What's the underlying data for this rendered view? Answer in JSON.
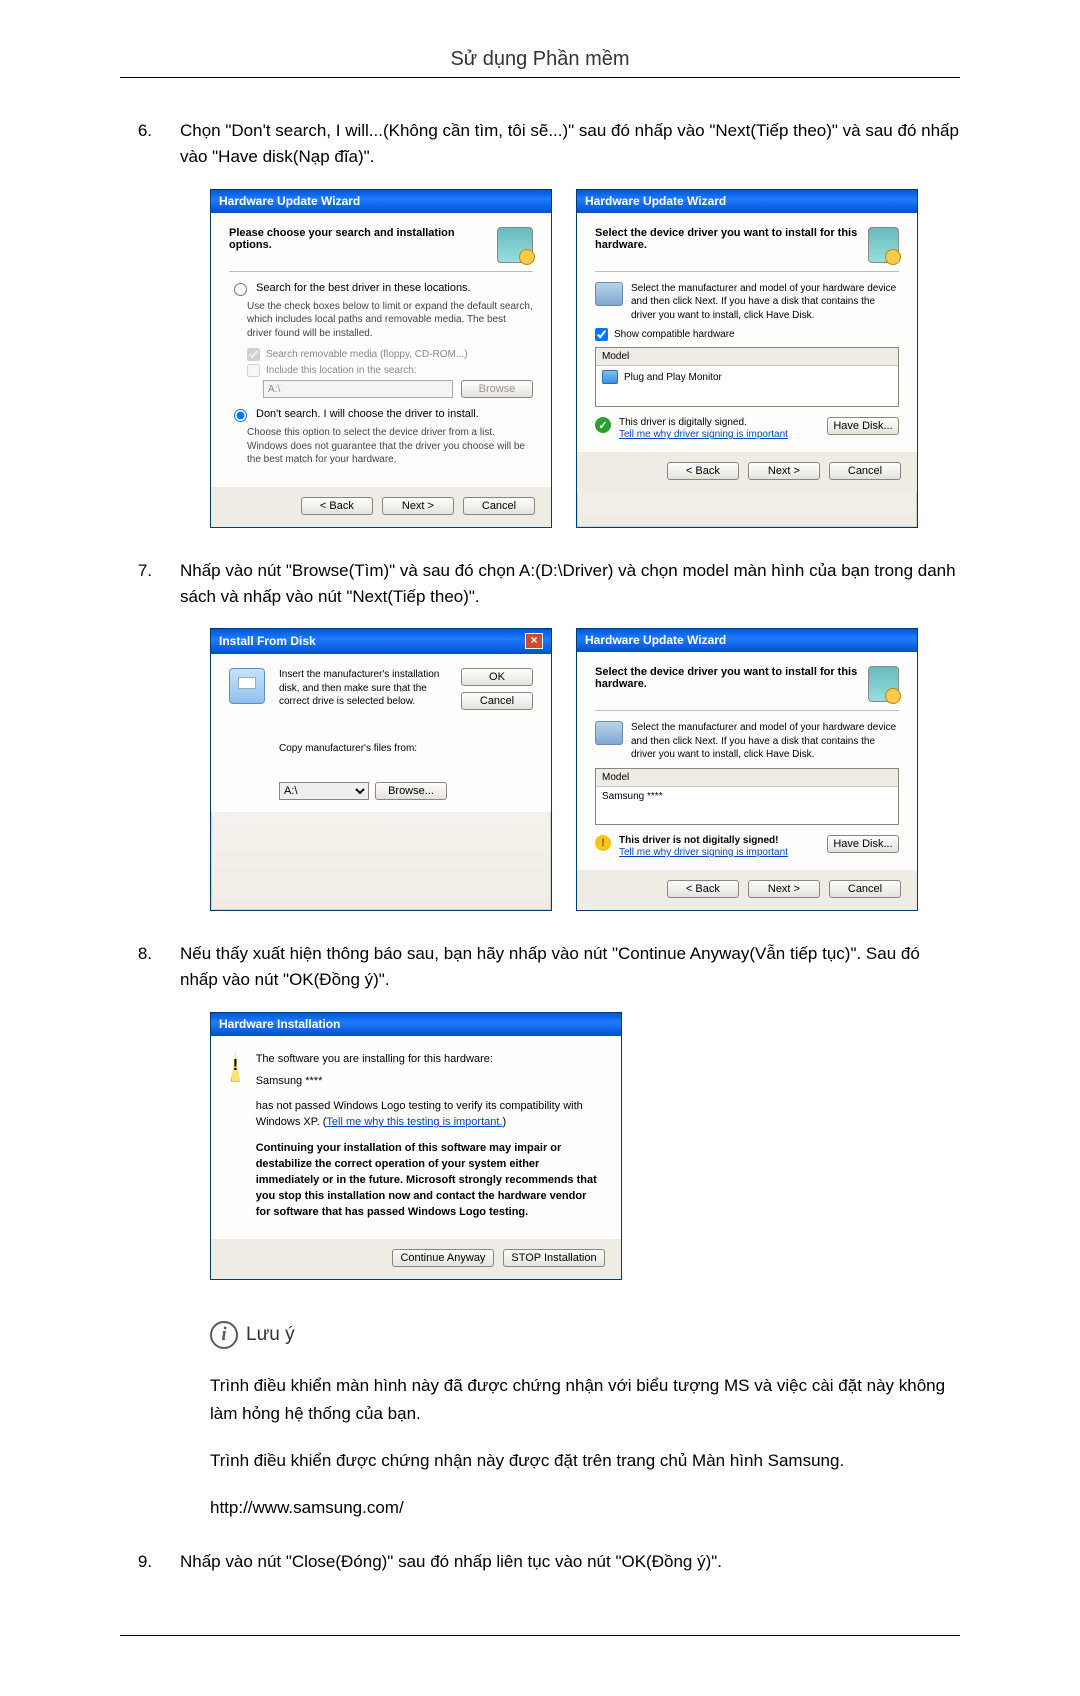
{
  "header": {
    "title": "Sử dụng Phần mềm"
  },
  "steps": {
    "s6": {
      "num": "6.",
      "text": "Chọn \"Don't search, I will...(Không cần tìm, tôi sẽ...)\" sau đó nhấp vào \"Next(Tiếp theo)\" và sau đó nhấp vào \"Have disk(Nạp đĩa)\"."
    },
    "s7": {
      "num": "7.",
      "text": "Nhấp vào nút \"Browse(Tìm)\" và sau đó chọn A:(D:\\Driver) và chọn model màn hình của bạn trong danh sách và nhấp vào nút \"Next(Tiếp theo)\"."
    },
    "s8": {
      "num": "8.",
      "text": "Nếu thấy xuất hiện thông báo sau, bạn hãy nhấp vào nút \"Continue Anyway(Vẫn tiếp tục)\". Sau đó nhấp vào nút \"OK(Đồng ý)\"."
    },
    "s9": {
      "num": "9.",
      "text": "Nhấp vào nút \"Close(Đóng)\" sau đó nhấp liên tục vào nút \"OK(Đồng ý)\"."
    }
  },
  "dlg1": {
    "title": "Hardware Update Wizard",
    "head": "Please choose your search and installation options.",
    "r1": "Search for the best driver in these locations.",
    "r1sub": "Use the check boxes below to limit or expand the default search, which includes local paths and removable media. The best driver found will be installed.",
    "c1": "Search removable media (floppy, CD-ROM...)",
    "c2": "Include this location in the search:",
    "path": "A:\\",
    "browse": "Browse",
    "r2": "Don't search. I will choose the driver to install.",
    "r2sub": "Choose this option to select the device driver from a list. Windows does not guarantee that the driver you choose will be the best match for your hardware.",
    "back": "< Back",
    "next": "Next >",
    "cancel": "Cancel"
  },
  "dlg2": {
    "title": "Hardware Update Wizard",
    "head": "Select the device driver you want to install for this hardware.",
    "info": "Select the manufacturer and model of your hardware device and then click Next. If you have a disk that contains the driver you want to install, click Have Disk.",
    "show": "Show compatible hardware",
    "model_head": "Model",
    "model_item": "Plug and Play Monitor",
    "signed": "This driver is digitally signed.",
    "tell": "Tell me why driver signing is important",
    "have": "Have Disk...",
    "back": "< Back",
    "next": "Next >",
    "cancel": "Cancel"
  },
  "ifd": {
    "title": "Install From Disk",
    "msg": "Insert the manufacturer's installation disk, and then make sure that the correct drive is selected below.",
    "ok": "OK",
    "cancel": "Cancel",
    "copy": "Copy manufacturer's files from:",
    "path": "A:\\",
    "browse": "Browse..."
  },
  "dlg3": {
    "title": "Hardware Update Wizard",
    "head": "Select the device driver you want to install for this hardware.",
    "info": "Select the manufacturer and model of your hardware device and then click Next. If you have a disk that contains the driver you want to install, click Have Disk.",
    "model_head": "Model",
    "model_item": "Samsung ****",
    "unsigned": "This driver is not digitally signed!",
    "tell": "Tell me why driver signing is important",
    "have": "Have Disk...",
    "back": "< Back",
    "next": "Next >",
    "cancel": "Cancel"
  },
  "warn": {
    "title": "Hardware Installation",
    "l1": "The software you are installing for this hardware:",
    "l2": "Samsung ****",
    "l3a": "has not passed Windows Logo testing to verify its compatibility with Windows XP. (",
    "l3link": "Tell me why this testing is important.",
    "l3b": ")",
    "bold": "Continuing your installation of this software may impair or destabilize the correct operation of your system either immediately or in the future. Microsoft strongly recommends that you stop this installation now and contact the hardware vendor for software that has passed Windows Logo testing.",
    "cont": "Continue Anyway",
    "stop": "STOP Installation"
  },
  "note": {
    "title": "Lưu ý",
    "p1": "Trình điều khiển màn hình này đã được chứng nhận với biểu tượng MS và việc cài đặt này không làm hỏng hệ thống của bạn.",
    "p2": "Trình điều khiển được chứng nhận này được đặt trên trang chủ Màn hình Samsung.",
    "p3": "http://www.samsung.com/"
  }
}
